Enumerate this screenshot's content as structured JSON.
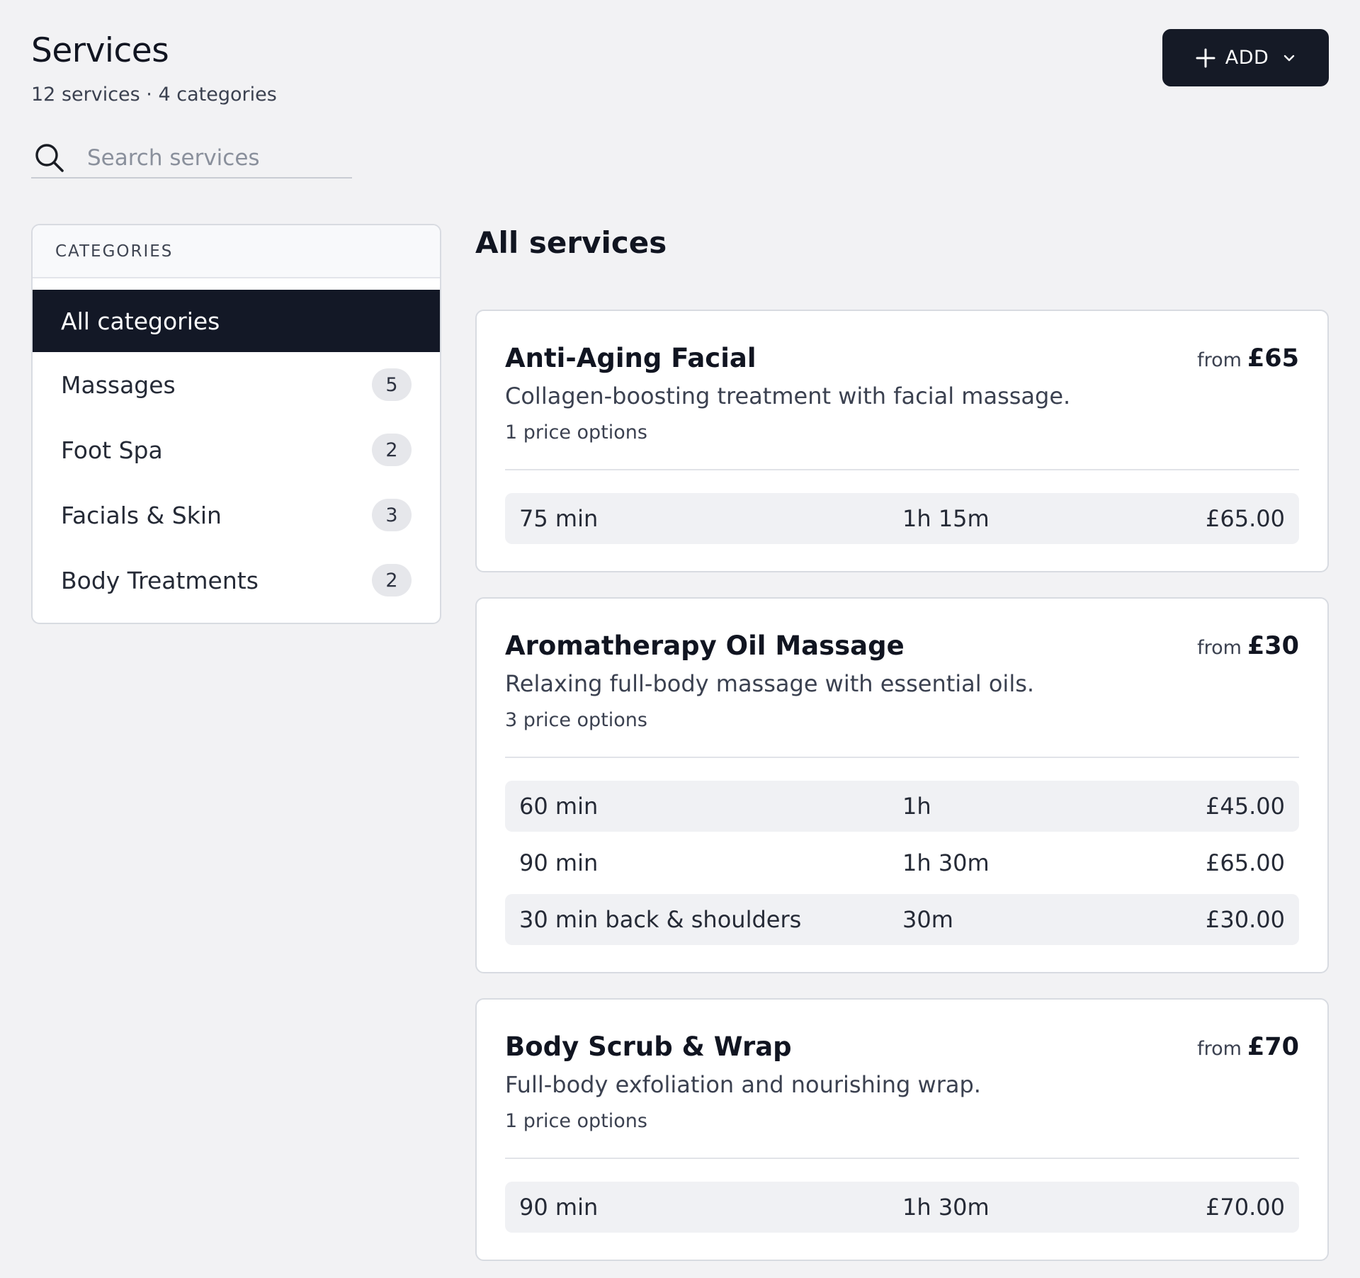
{
  "header": {
    "title": "Services",
    "subtitle": "12 services · 4 categories",
    "add_label": "ADD"
  },
  "search": {
    "placeholder": "Search services"
  },
  "categories": {
    "heading": "CATEGORIES",
    "all_label": "All categories",
    "items": [
      {
        "label": "Massages",
        "count": "5"
      },
      {
        "label": "Foot Spa",
        "count": "2"
      },
      {
        "label": "Facials & Skin",
        "count": "3"
      },
      {
        "label": "Body Treatments",
        "count": "2"
      }
    ]
  },
  "main": {
    "section_title": "All services",
    "from_label": "from",
    "services": [
      {
        "name": "Anti-Aging Facial",
        "from_price": "£65",
        "description": "Collagen-boosting treatment with facial massage.",
        "price_options": "1 price options",
        "options": [
          {
            "name": "75 min",
            "duration": "1h 15m",
            "price": "£65.00"
          }
        ]
      },
      {
        "name": "Aromatherapy Oil Massage",
        "from_price": "£30",
        "description": "Relaxing full-body massage with essential oils.",
        "price_options": "3 price options",
        "options": [
          {
            "name": "60 min",
            "duration": "1h",
            "price": "£45.00"
          },
          {
            "name": "90 min",
            "duration": "1h 30m",
            "price": "£65.00"
          },
          {
            "name": "30 min back & shoulders",
            "duration": "30m",
            "price": "£30.00"
          }
        ]
      },
      {
        "name": "Body Scrub & Wrap",
        "from_price": "£70",
        "description": "Full-body exfoliation and nourishing wrap.",
        "price_options": "1 price options",
        "options": [
          {
            "name": "90 min",
            "duration": "1h 30m",
            "price": "£70.00"
          }
        ]
      }
    ]
  },
  "colors": {
    "background": "#f2f2f4",
    "primary_dark": "#151a26",
    "card": "#ffffff",
    "row_shade": "#f0f1f4"
  }
}
